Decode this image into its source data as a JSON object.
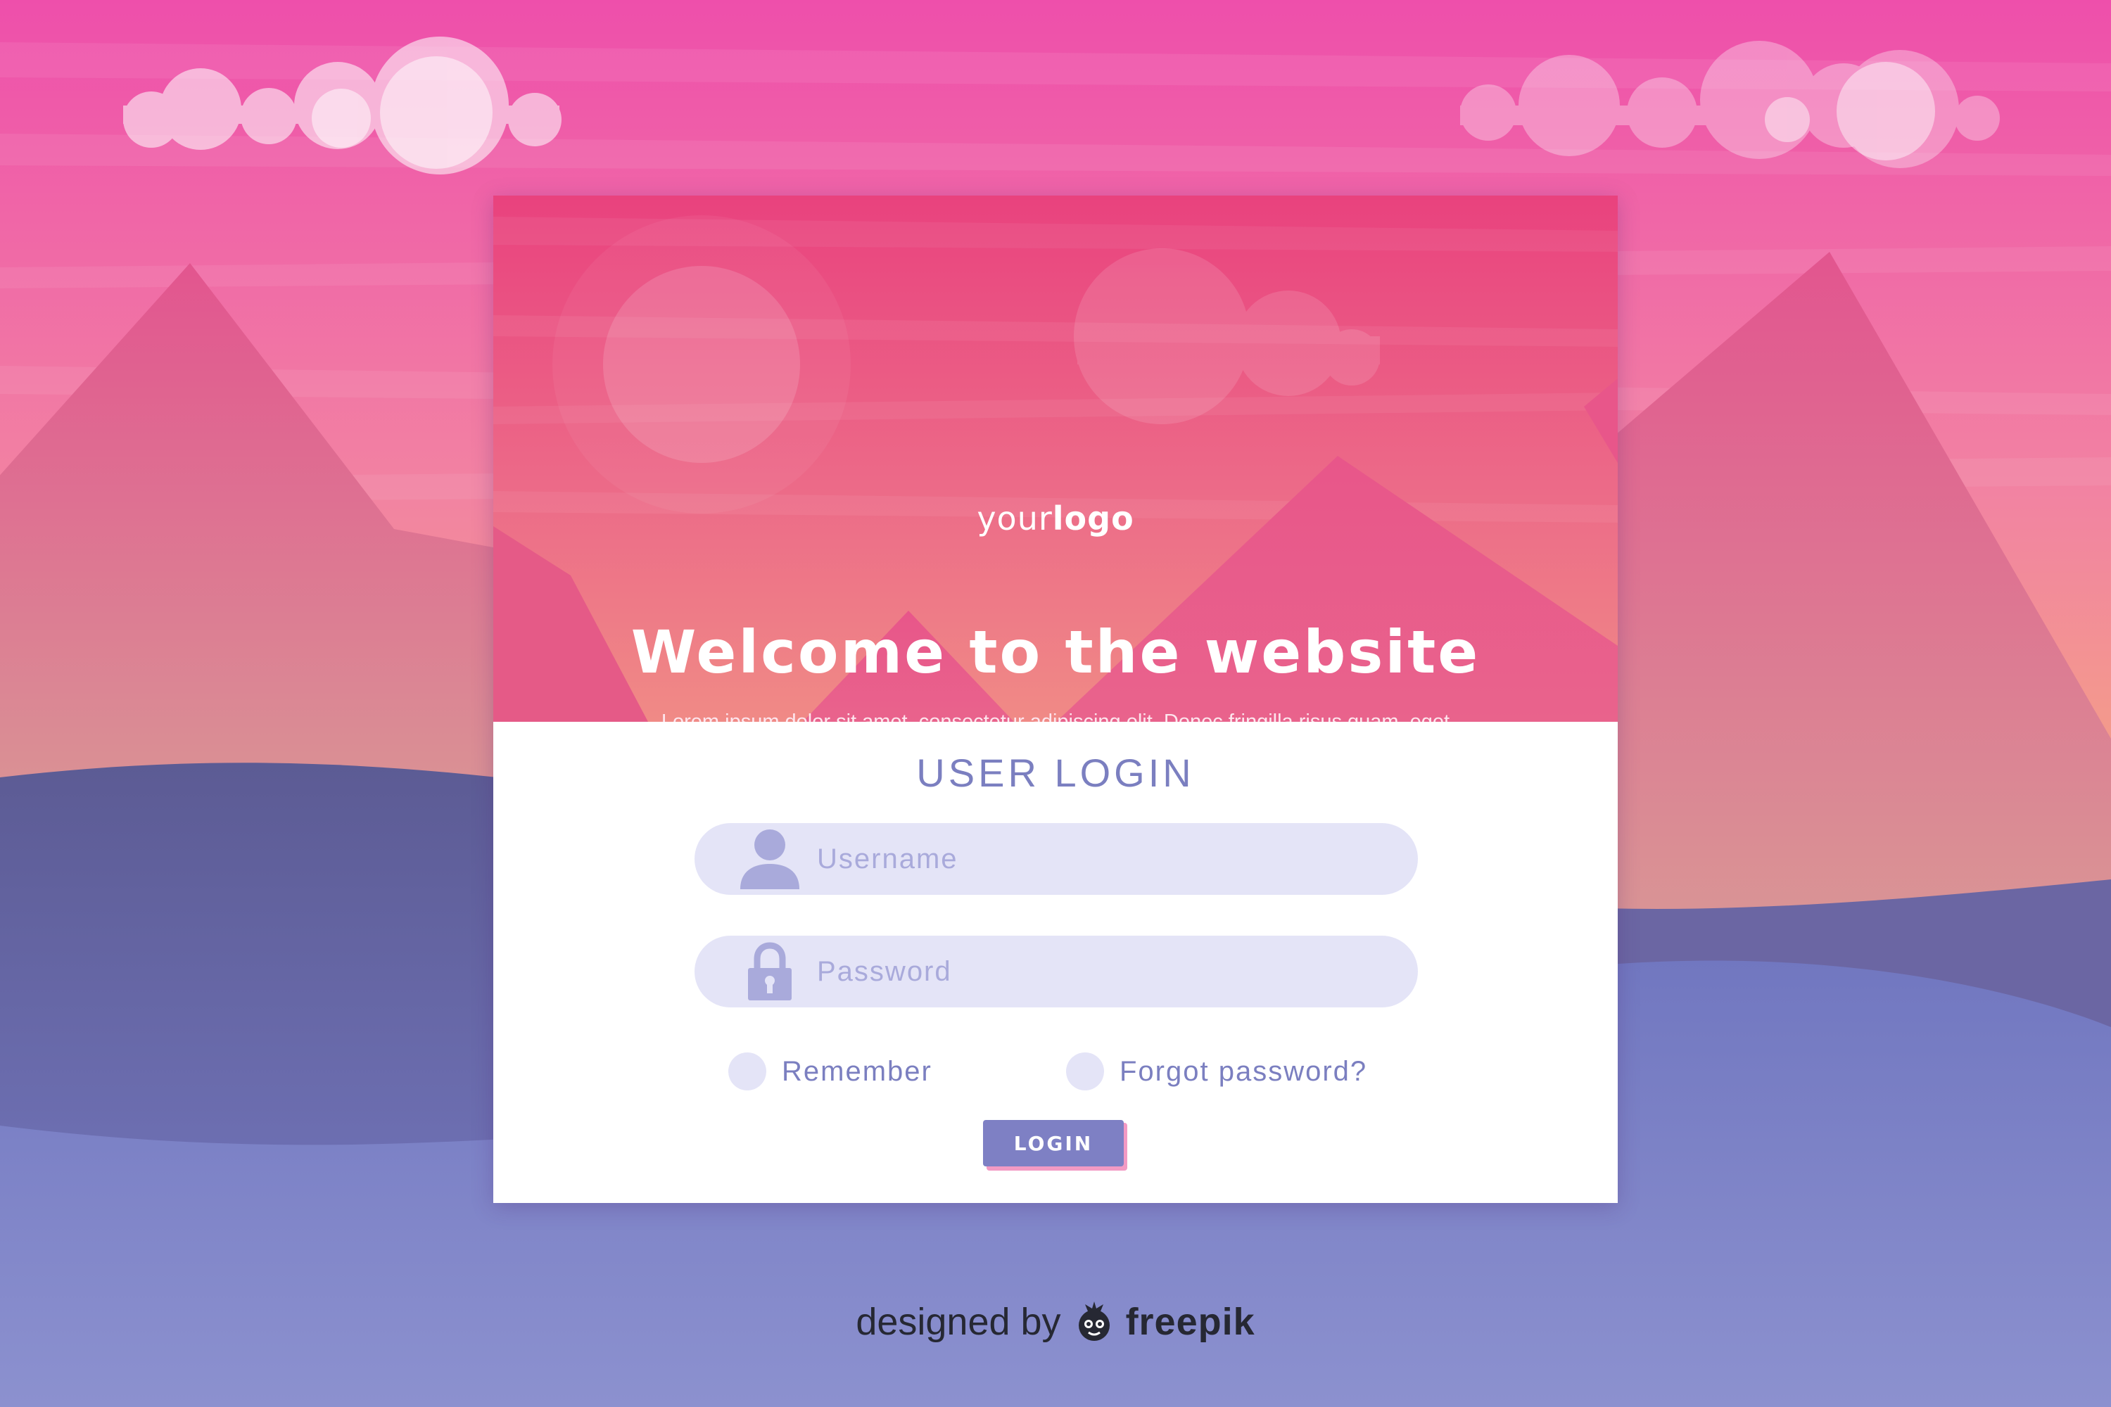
{
  "colors": {
    "sky_top": "#ee4fab",
    "sky_mid": "#f283a2",
    "sky_bottom": "#f4a77f",
    "mountain": "#e0608f",
    "hill_dark": "#5f5f96",
    "ground": "#8d92d0",
    "header_pink": "#e9497e",
    "accent": "#7e80c4",
    "field_bg": "#e4e4f7",
    "button_shadow": "#f39ac4"
  },
  "header": {
    "logo_light": "your",
    "logo_bold": "logo",
    "title": "Welcome to the website",
    "description": "Lorem ipsum dolor sit amet, consectetur adipiscing elit. Donec fringilla risus quam, eget interdum est tempor at. Nam quis ultricies leo. Pellentesque volutpat magna neque. Sample text description text goes here."
  },
  "login": {
    "title": "USER LOGIN",
    "username": {
      "placeholder": "Username",
      "value": "",
      "icon": "user-icon"
    },
    "password": {
      "placeholder": "Password",
      "value": "",
      "icon": "lock-icon"
    },
    "remember_label": "Remember",
    "forgot_label": "Forgot password?",
    "button_label": "LOGIN"
  },
  "credit": {
    "prefix": "designed by",
    "brand": "freepik",
    "icon": "freepik-mascot-icon"
  }
}
